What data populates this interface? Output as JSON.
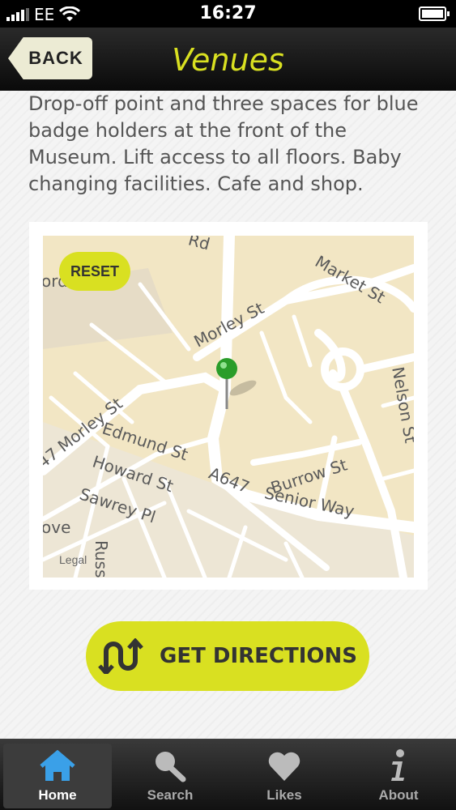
{
  "status_bar": {
    "carrier": "EE",
    "time": "16:27"
  },
  "nav": {
    "back_label": "BACK",
    "title": "Venues"
  },
  "description": "Drop-off point and three spaces for blue badge holders at the front of the Museum. Lift access to all floors. Baby changing facilities. Cafe and shop.",
  "map": {
    "reset_label": "RESET",
    "legal_label": "Legal",
    "labels": {
      "rd": "Rd",
      "market_st": "Market St",
      "morley_st_top": "Morley St",
      "nelson_st": "Nelson St",
      "morley_st_left": "47 Morley St",
      "edmund_st": "Edmund St",
      "howard_st": "Howard St",
      "a647": "A647",
      "burrow_st": "Burrow St",
      "senior_way": "Senior Way",
      "sawrey_pl": "Sawrey Pl",
      "russell": "Russel",
      "ove": "ove",
      "ord": "ord"
    }
  },
  "directions_label": "GET DIRECTIONS",
  "tabs": [
    {
      "label": "Home",
      "icon": "home-icon",
      "active": true
    },
    {
      "label": "Search",
      "icon": "search-icon",
      "active": false
    },
    {
      "label": "Likes",
      "icon": "heart-icon",
      "active": false
    },
    {
      "label": "About",
      "icon": "info-icon",
      "active": false
    }
  ],
  "colors": {
    "accent": "#d9e021",
    "map_land": "#f2e6c4"
  }
}
